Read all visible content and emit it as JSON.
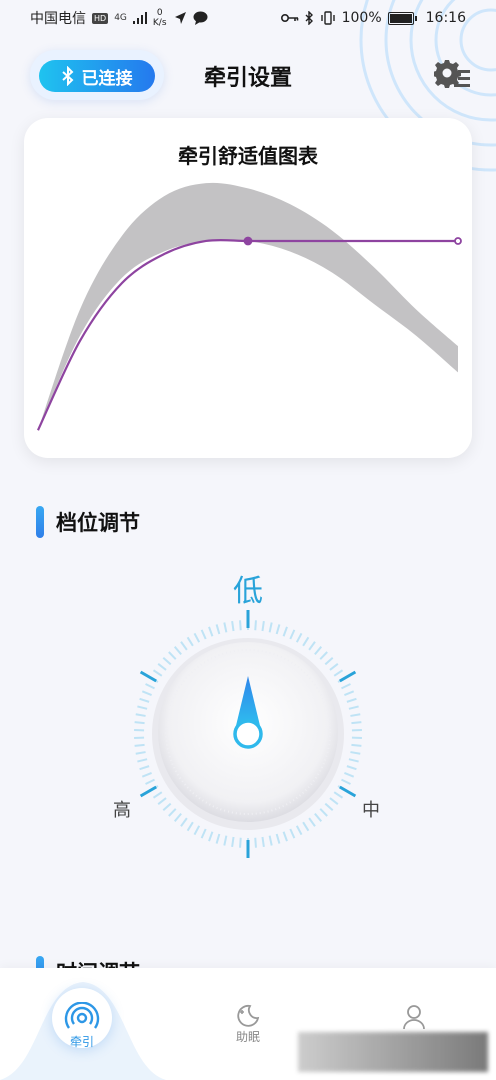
{
  "status_bar": {
    "carrier": "中国电信",
    "hd_badge": "HD",
    "net_type": "4G",
    "net_speed_value": "0",
    "net_speed_unit": "K/s",
    "battery_percent": "100%",
    "time": "16:16"
  },
  "header": {
    "bluetooth_status": "已连接",
    "title": "牵引设置"
  },
  "chart": {
    "title": "牵引舒适值图表"
  },
  "chart_data": {
    "type": "area",
    "title": "牵引舒适值图表",
    "xlabel": "",
    "ylabel": "",
    "grid": false,
    "legend": "none",
    "x": [
      0,
      0.1,
      0.2,
      0.3,
      0.4,
      0.5,
      0.6,
      0.7,
      0.8,
      0.9,
      1.0
    ],
    "band_upper": [
      0.06,
      0.52,
      0.8,
      0.95,
      1.0,
      0.98,
      0.92,
      0.82,
      0.68,
      0.52,
      0.38
    ],
    "band_lower": [
      0.06,
      0.42,
      0.64,
      0.74,
      0.78,
      0.78,
      0.74,
      0.66,
      0.54,
      0.42,
      0.28
    ],
    "series": [
      {
        "values": [
          0.06,
          0.4,
          0.62,
          0.73,
          0.78,
          0.78,
          0.78,
          0.78,
          0.78,
          0.78,
          0.78
        ],
        "color": "#8e44a0"
      }
    ],
    "markers_x": [
      0.5,
      1.0
    ],
    "band_color": "#c3c2c4",
    "ylim": [
      0,
      1.05
    ]
  },
  "gear_section": {
    "label": "档位调节",
    "low_label": "低",
    "mid_label": "中",
    "high_label": "高",
    "current": "低",
    "accent": "#29a3d9"
  },
  "time_section": {
    "label": "时间调节"
  },
  "bottom_nav": {
    "items": [
      {
        "label": "牵引",
        "icon": "traction-icon",
        "active": true
      },
      {
        "label": "助眠",
        "icon": "sleep-icon",
        "active": false
      },
      {
        "label": "",
        "icon": "user-icon",
        "active": false
      }
    ]
  }
}
